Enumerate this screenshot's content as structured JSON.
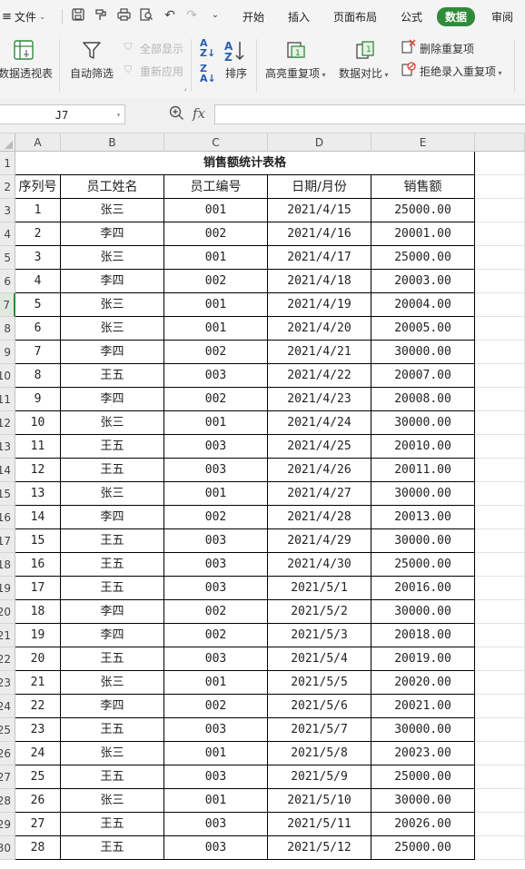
{
  "menu": {
    "file_label": "文件",
    "tabs": [
      "开始",
      "插入",
      "页面布局",
      "公式",
      "数据",
      "审阅"
    ],
    "active_tab": "数据"
  },
  "ribbon": {
    "pivot_label": "数据透视表",
    "autofilter_label": "自动筛选",
    "show_all_label": "全部显示",
    "reapply_label": "重新应用",
    "sort_label": "排序",
    "highlight_dup_label": "高亮重复项",
    "compare_label": "数据对比",
    "remove_dup_label": "删除重复项",
    "reject_dup_label": "拒绝录入重复项"
  },
  "formula_bar": {
    "name_box": "J7",
    "fx_label": "fx",
    "formula": ""
  },
  "sheet": {
    "columns": [
      "A",
      "B",
      "C",
      "D",
      "E"
    ],
    "row_numbers": [
      "1",
      "2",
      "3",
      "4",
      "5",
      "6",
      "7",
      "8",
      "9",
      "10",
      "11",
      "12",
      "13",
      "14",
      "15",
      "16",
      "17",
      "18",
      "19",
      "20",
      "21",
      "22",
      "23",
      "24",
      "25",
      "26",
      "27",
      "28",
      "29",
      "30"
    ],
    "title": "销售额统计表格",
    "headers": [
      "序列号",
      "员工姓名",
      "员工编号",
      "日期/月份",
      "销售额"
    ],
    "rows": [
      [
        "1",
        "张三",
        "001",
        "2021/4/15",
        "25000.00"
      ],
      [
        "2",
        "李四",
        "002",
        "2021/4/16",
        "20001.00"
      ],
      [
        "3",
        "张三",
        "001",
        "2021/4/17",
        "25000.00"
      ],
      [
        "4",
        "李四",
        "002",
        "2021/4/18",
        "20003.00"
      ],
      [
        "5",
        "张三",
        "001",
        "2021/4/19",
        "20004.00"
      ],
      [
        "6",
        "张三",
        "001",
        "2021/4/20",
        "20005.00"
      ],
      [
        "7",
        "李四",
        "002",
        "2021/4/21",
        "30000.00"
      ],
      [
        "8",
        "王五",
        "003",
        "2021/4/22",
        "20007.00"
      ],
      [
        "9",
        "李四",
        "002",
        "2021/4/23",
        "20008.00"
      ],
      [
        "10",
        "张三",
        "001",
        "2021/4/24",
        "30000.00"
      ],
      [
        "11",
        "王五",
        "003",
        "2021/4/25",
        "20010.00"
      ],
      [
        "12",
        "王五",
        "003",
        "2021/4/26",
        "20011.00"
      ],
      [
        "13",
        "张三",
        "001",
        "2021/4/27",
        "30000.00"
      ],
      [
        "14",
        "李四",
        "002",
        "2021/4/28",
        "20013.00"
      ],
      [
        "15",
        "王五",
        "003",
        "2021/4/29",
        "30000.00"
      ],
      [
        "16",
        "王五",
        "003",
        "2021/4/30",
        "25000.00"
      ],
      [
        "17",
        "王五",
        "003",
        "2021/5/1",
        "20016.00"
      ],
      [
        "18",
        "李四",
        "002",
        "2021/5/2",
        "30000.00"
      ],
      [
        "19",
        "李四",
        "002",
        "2021/5/3",
        "20018.00"
      ],
      [
        "20",
        "王五",
        "003",
        "2021/5/4",
        "20019.00"
      ],
      [
        "21",
        "张三",
        "001",
        "2021/5/5",
        "20020.00"
      ],
      [
        "22",
        "李四",
        "002",
        "2021/5/6",
        "20021.00"
      ],
      [
        "23",
        "王五",
        "003",
        "2021/5/7",
        "30000.00"
      ],
      [
        "24",
        "张三",
        "001",
        "2021/5/8",
        "20023.00"
      ],
      [
        "25",
        "王五",
        "003",
        "2021/5/9",
        "25000.00"
      ],
      [
        "26",
        "张三",
        "001",
        "2021/5/10",
        "30000.00"
      ],
      [
        "27",
        "王五",
        "003",
        "2021/5/11",
        "20026.00"
      ],
      [
        "28",
        "王五",
        "003",
        "2021/5/12",
        "25000.00"
      ]
    ]
  },
  "colors": {
    "accent": "#2e8b3a",
    "header_bg": "#ececec"
  }
}
